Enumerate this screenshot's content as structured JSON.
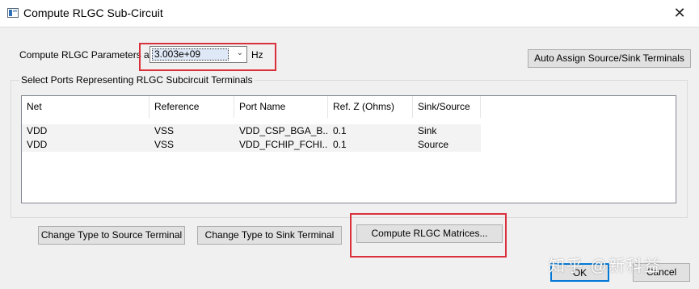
{
  "window": {
    "title": "Compute RLGC Sub-Circuit",
    "close_glyph": "✕",
    "app_icon": "app-icon"
  },
  "frequency": {
    "label": "Compute RLGC Parameters at",
    "value": "3.003e+09",
    "unit": "Hz"
  },
  "auto_assign_label": "Auto Assign Source/Sink Terminals",
  "ports_group": {
    "label": "Select Ports Representing RLGC Subcircuit Terminals",
    "columns": [
      "Net",
      "Reference",
      "Port Name",
      "Ref. Z (Ohms)",
      "Sink/Source"
    ],
    "rows": [
      [
        "VDD",
        "VSS",
        "VDD_CSP_BGA_B...",
        "0.1",
        "Sink"
      ],
      [
        "VDD",
        "VSS",
        "VDD_FCHIP_FCHI...",
        "0.1",
        "Source"
      ]
    ]
  },
  "buttons": {
    "change_source": "Change Type to Source Terminal",
    "change_sink": "Change Type to Sink Terminal",
    "compute_matrices": "Compute RLGC Matrices...",
    "ok": "OK",
    "cancel": "Cancel"
  },
  "watermark": "知乎 @新科益",
  "colors": {
    "highlight": "#d9303a",
    "dialog_bg": "#f0f0f0"
  }
}
